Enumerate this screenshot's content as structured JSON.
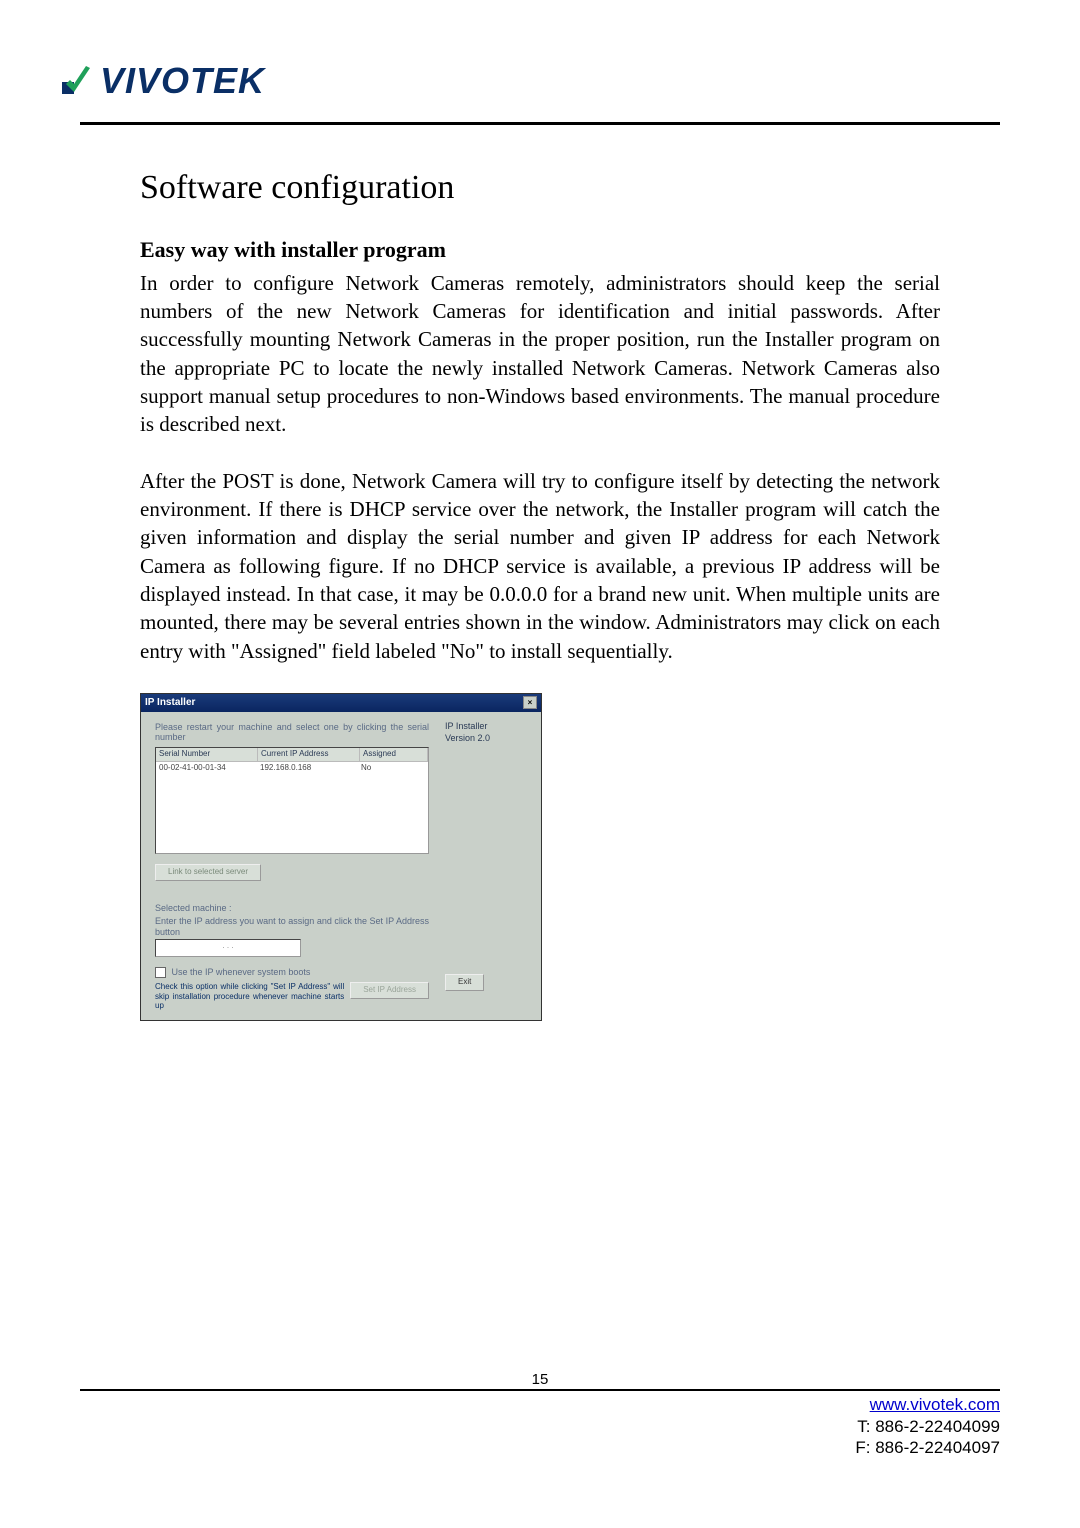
{
  "logo_text": "VIVOTEK",
  "heading": "Software configuration",
  "subheading": "Easy way with installer program",
  "para1": "In order to configure Network Cameras remotely, administrators should keep the serial numbers of the new Network Cameras for identification and initial passwords. After successfully mounting Network Cameras in the proper position, run the Installer program on the appropriate PC to locate the newly installed Network Cameras. Network Cameras also support manual setup procedures to non-Windows based environments. The manual procedure is described next.",
  "para2": "After the POST is done, Network Camera will try to configure itself by detecting the network environment. If there is DHCP service over the network, the Installer program will catch the given information and display the serial number and given IP address for each Network Camera as following figure. If no DHCP service is available, a previous IP address will be displayed instead. In that case, it may be 0.0.0.0 for a brand new unit. When multiple units are mounted, there may be several entries shown in the window. Administrators may click on each entry with \"Assigned\" field labeled \"No\" to install sequentially.",
  "dialog": {
    "title": "IP Installer",
    "app_name": "IP Installer",
    "version": "Version 2.0",
    "instruction": "Please restart your machine and select one by clicking the serial number",
    "columns": {
      "c1": "Serial Number",
      "c2": "Current IP Address",
      "c3": "Assigned"
    },
    "row": {
      "serial": "00-02-41-00-01-34",
      "ip": "192.168.0.168",
      "assigned": "No"
    },
    "link_btn": "Link to selected server",
    "selected_label": "Selected machine :",
    "enter_ip_label": "Enter the IP address you want to assign and click the Set IP Address button",
    "ip_dots": ". . .",
    "reset_chk_label": "Use the IP whenever system boots",
    "reset_note": "Check this option while clicking \"Set IP Address\" will skip installation procedure whenever machine starts up",
    "set_btn": "Set IP Address",
    "exit_btn": "Exit"
  },
  "page_number": "15",
  "footer": {
    "url": "www.vivotek.com",
    "tel": "T: 886-2-22404099",
    "fax": "F: 886-2-22404097"
  }
}
